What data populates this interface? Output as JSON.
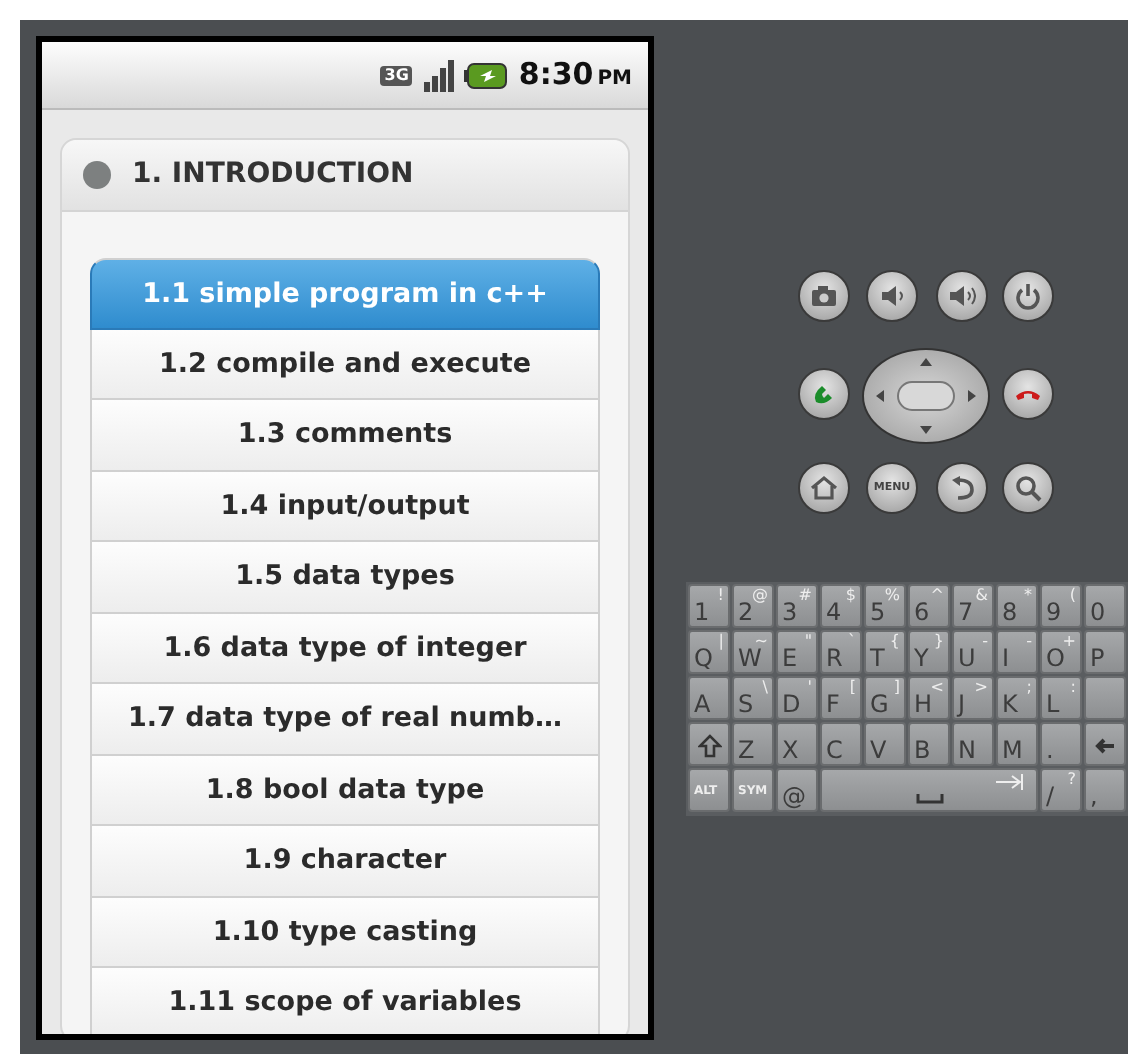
{
  "status_bar": {
    "network": "3G",
    "time": "8:30",
    "ampm": "PM"
  },
  "section": {
    "title": "1. INTRODUCTION",
    "expanded": true
  },
  "items": [
    {
      "label": "1.1 simple program in c++",
      "selected": true
    },
    {
      "label": "1.2 compile and execute",
      "selected": false
    },
    {
      "label": "1.3 comments",
      "selected": false
    },
    {
      "label": "1.4 input/output",
      "selected": false
    },
    {
      "label": "1.5 data types",
      "selected": false
    },
    {
      "label": "1.6 data type of integer",
      "selected": false
    },
    {
      "label": "1.7 data type of real numb…",
      "selected": false
    },
    {
      "label": "1.8 bool data type",
      "selected": false
    },
    {
      "label": "1.9 character",
      "selected": false
    },
    {
      "label": "1.10 type casting",
      "selected": false
    },
    {
      "label": "1.11 scope of variables",
      "selected": false
    }
  ],
  "controls": {
    "menu_label": "MENU"
  },
  "keyboard": [
    [
      {
        "main": "1",
        "alt": "!"
      },
      {
        "main": "2",
        "alt": "@"
      },
      {
        "main": "3",
        "alt": "#"
      },
      {
        "main": "4",
        "alt": "$"
      },
      {
        "main": "5",
        "alt": "%"
      },
      {
        "main": "6",
        "alt": "^"
      },
      {
        "main": "7",
        "alt": "&"
      },
      {
        "main": "8",
        "alt": "*"
      },
      {
        "main": "9",
        "alt": "("
      },
      {
        "main": "0"
      }
    ],
    [
      {
        "main": "Q",
        "alt": "|"
      },
      {
        "main": "W",
        "alt": "~"
      },
      {
        "main": "E",
        "alt": "\""
      },
      {
        "main": "R",
        "alt": "`"
      },
      {
        "main": "T",
        "alt": "{"
      },
      {
        "main": "Y",
        "alt": "}"
      },
      {
        "main": "U",
        "alt": "-"
      },
      {
        "main": "I",
        "alt": "-"
      },
      {
        "main": "O",
        "alt": "+"
      },
      {
        "main": "P"
      }
    ],
    [
      {
        "main": "A"
      },
      {
        "main": "S",
        "alt": "\\"
      },
      {
        "main": "D",
        "alt": "'"
      },
      {
        "main": "F",
        "alt": "["
      },
      {
        "main": "G",
        "alt": "]"
      },
      {
        "main": "H",
        "alt": "<"
      },
      {
        "main": "J",
        "alt": ">"
      },
      {
        "main": "K",
        "alt": ";"
      },
      {
        "main": "L",
        "alt": ":"
      },
      {
        "kind": "blank"
      }
    ],
    [
      {
        "kind": "shift"
      },
      {
        "main": "Z"
      },
      {
        "main": "X"
      },
      {
        "main": "C"
      },
      {
        "main": "V"
      },
      {
        "main": "B"
      },
      {
        "main": "N"
      },
      {
        "main": "M"
      },
      {
        "main": "."
      },
      {
        "kind": "backspace"
      }
    ],
    [
      {
        "main": "ALT",
        "kind": "small"
      },
      {
        "main": "SYM",
        "kind": "small"
      },
      {
        "main": "@"
      },
      {
        "kind": "space"
      },
      {
        "main": "/",
        "alt": "?"
      },
      {
        "main": ","
      }
    ]
  ]
}
